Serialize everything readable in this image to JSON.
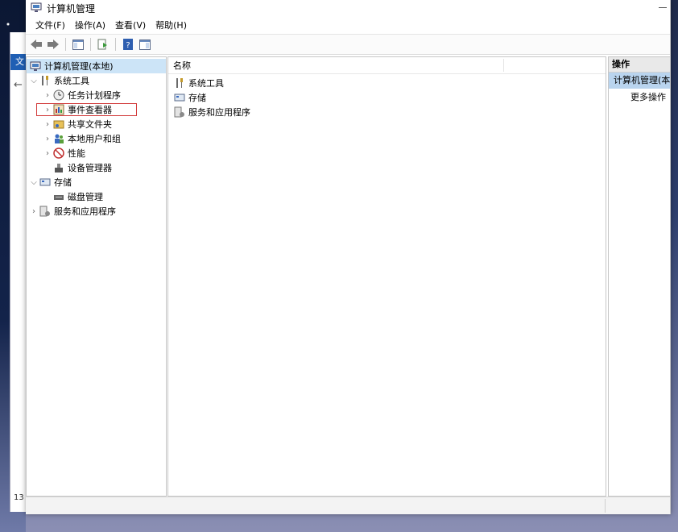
{
  "window": {
    "title": "计算机管理"
  },
  "menu": [
    "文件(F)",
    "操作(A)",
    "查看(V)",
    "帮助(H)"
  ],
  "background": {
    "tab_label": "文",
    "counter": "13"
  },
  "tree": {
    "root": "计算机管理(本地)",
    "system_tools": "系统工具",
    "task_scheduler": "任务计划程序",
    "event_viewer": "事件查看器",
    "shared_folders": "共享文件夹",
    "local_users": "本地用户和组",
    "performance": "性能",
    "device_manager": "设备管理器",
    "storage": "存储",
    "disk_management": "磁盘管理",
    "services_apps": "服务和应用程序"
  },
  "center": {
    "column_name": "名称",
    "items": [
      "系统工具",
      "存储",
      "服务和应用程序"
    ]
  },
  "actions": {
    "header": "操作",
    "section": "计算机管理(本",
    "more": "更多操作"
  },
  "colors": {
    "selection": "#cce4f7",
    "highlight_box": "#d23a3a",
    "action_section": "#b9d4ee"
  }
}
